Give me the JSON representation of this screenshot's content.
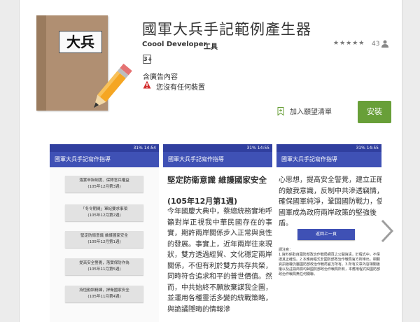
{
  "app": {
    "title": "國軍大兵手記範例產生器",
    "icon_text": "大兵",
    "developer": "Coool Developer",
    "category": "工具",
    "rating_stars": "★★★★★",
    "rating_count": "43",
    "content_rating": "3+",
    "ads_label": "含廣告內容",
    "compat_warning": "您沒有任何裝置",
    "wishlist_label": "加入願望清單",
    "install_label": "安裝"
  },
  "colors": {
    "install_green": "#689f38",
    "appbar_indigo": "#3f51b5",
    "statusbar_indigo": "#303f9f",
    "warning_red": "#d32f2f"
  },
  "screenshots": {
    "status_time_1": "31% 14:54",
    "status_time_2": "31% 14:55",
    "status_time_3": "31% 14:55",
    "appbar_title": "國軍大兵手記寫作指導",
    "list_items": [
      {
        "line1": "落實申訴制度、保障官兵權益",
        "line2": "(105年12月第3週)"
      },
      {
        "line1": "「冬令期間」軍紀要求事項",
        "line2": "(105年12月第2週)"
      },
      {
        "line1": "堅定防衛意識 維護國家安全",
        "line2": "(105年12月第1週)"
      },
      {
        "line1": "提高安全警覺，落實保防作為",
        "line2": "(105年11月第5週)"
      },
      {
        "line1": "持恆勤訓精練，捍衛國家安全",
        "line2": "(105年11月第4週)"
      }
    ],
    "article_title": "堅定防衛意識 維護國家安全",
    "article_date": "(105年12月第1週)",
    "article_body": "今年國慶大典中，蔡總統務實地呼籲對岸正視我中華民國存在的事實，期許兩岸關係步入正常與良性的發展。事實上，近年兩岸往來現狀，雙方透過經貿、文化穩定兩岸關係，不但有利於雙方共存共榮，同時符合追求和平的普世價值。然而，中共始終不願放棄謀我企圖，並運用各種靈活多變的統戰策略，與詭譎隱晦的情報滲",
    "continued_body": "心思想，提高安全警覺，建立正確的敵我意識，反制中共滲透竊情，確保國軍純淨，鞏固國防戰力，使國軍成為政府兩岸政策的堅強後盾。",
    "back_button": "返回上一頁",
    "note_heading": "請注意：",
    "note_body": "1.資料係取自國防部政治作戰局網頁之公開資訊，於程式中，不保證其正確性。2.本應用程式非國防部政治作戰局官方所推出，相關資訊版權仍屬國防部政治作戰局官方所有。3.所有文章內容相關版權以及註冊商標均歸國防部政治作戰局所有，本應用程式與國防部政治作戰局無任何關聯。"
  }
}
